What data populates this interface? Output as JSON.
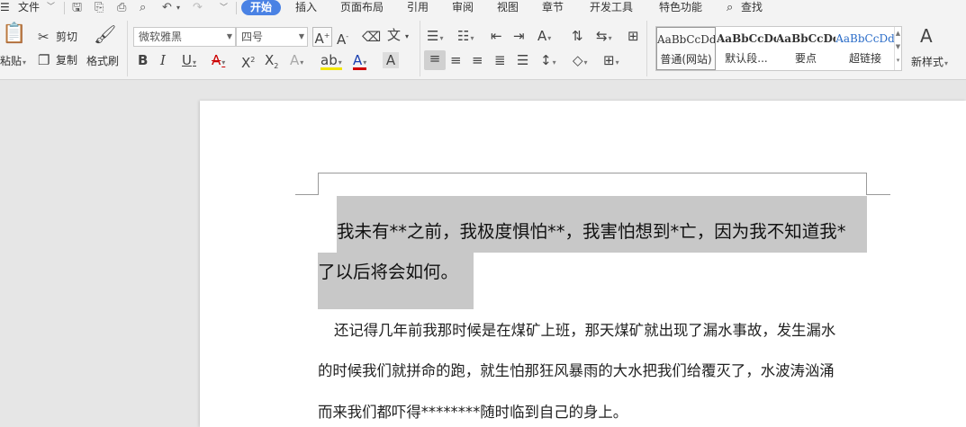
{
  "menu": {
    "file_label": "文件",
    "tabs": [
      "开始",
      "插入",
      "页面布局",
      "引用",
      "审阅",
      "视图",
      "章节",
      "开发工具",
      "特色功能"
    ],
    "search_label": "查找"
  },
  "ribbon": {
    "paste_label": "粘贴",
    "cut_label": "剪切",
    "copy_label": "复制",
    "format_painter_label": "格式刷",
    "font_name": "微软雅黑",
    "font_size": "四号",
    "styles": [
      {
        "sample": "AaBbCcDd",
        "name": "普通(网站)"
      },
      {
        "sample": "AaBbCcDd",
        "name": "默认段..."
      },
      {
        "sample": "AaBbCcDd",
        "name": "要点"
      },
      {
        "sample": "AaBbCcDd",
        "name": "超链接"
      }
    ],
    "new_style_label": "新样式"
  },
  "document": {
    "paragraph1": [
      "我未有**之前，我极度惧怕**，我害怕想到*亡，因为我不知道我*",
      "了以后将会如何。"
    ],
    "paragraph2": [
      "还记得几年前我那时候是在煤矿上班，那天煤矿就出现了漏水事故，发生漏水",
      "的时候我们就拼命的跑，就生怕那狂风暴雨的大水把我们给覆灭了，水波涛汹涌",
      "而来我们都吓得********随时临到自己的身上。"
    ]
  },
  "colors": {
    "accent": "#4a82e4",
    "selection": "#c8c8c8",
    "link_style": "#2a6cc8"
  }
}
